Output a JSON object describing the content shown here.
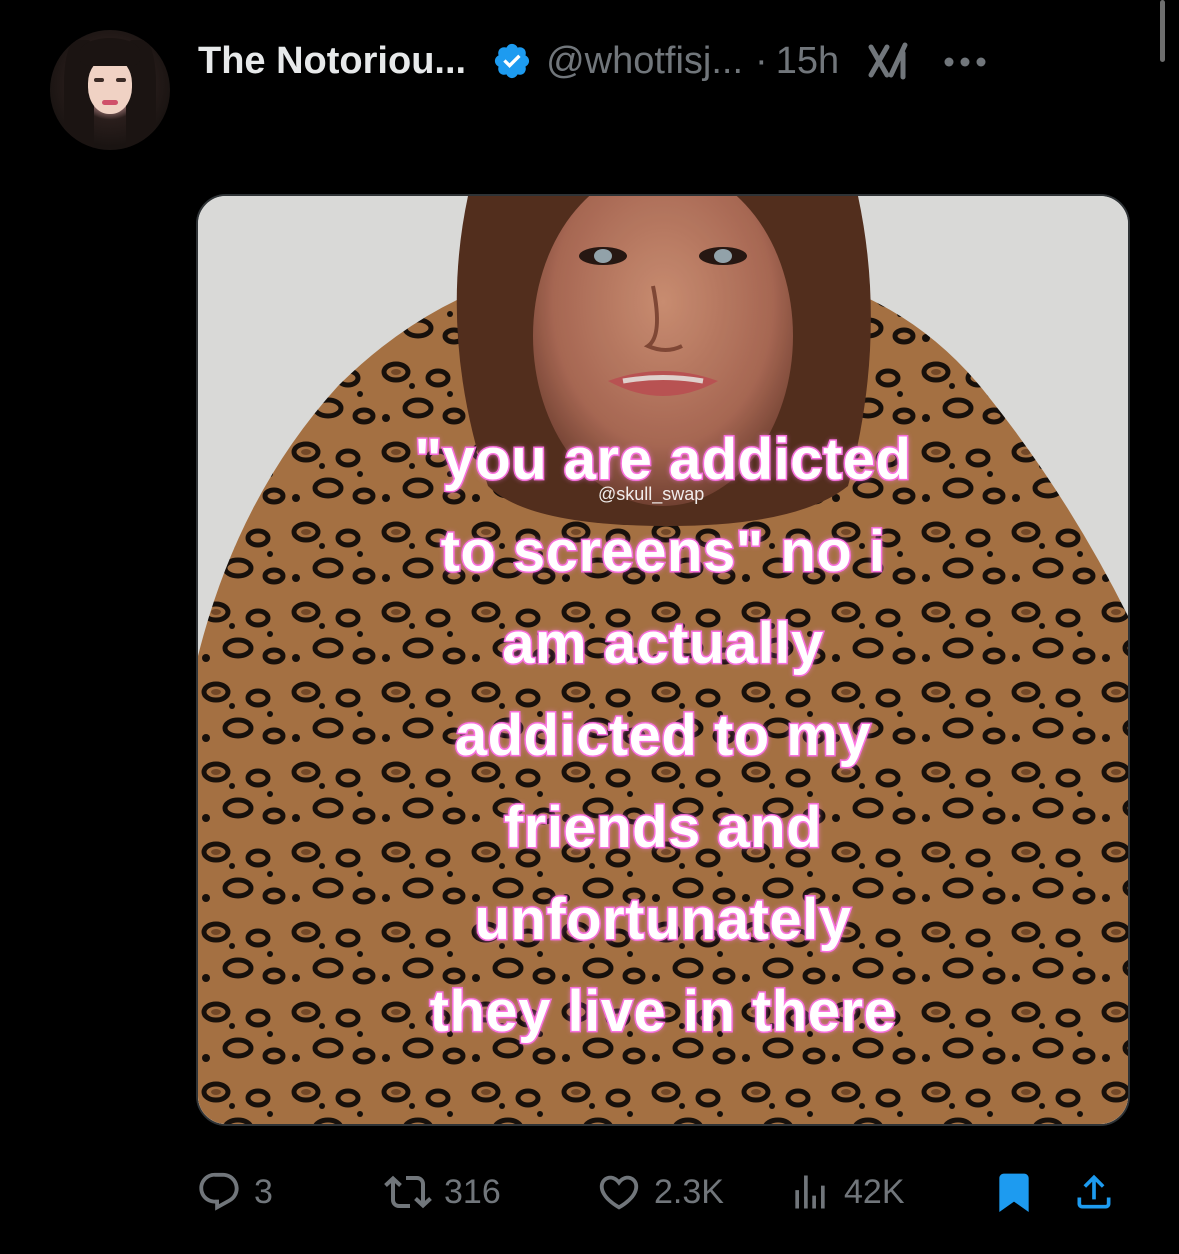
{
  "tweet": {
    "display_name": "The Notoriou...",
    "handle": "@whotfisj...",
    "separator": "·",
    "time": "15h"
  },
  "media": {
    "meme_lines": [
      "\"you are addicted",
      "to screens\" no i",
      "am actually",
      "addicted to my",
      "friends and",
      "unfortunately",
      "they live in there"
    ],
    "watermark": "@skull_swap"
  },
  "actions": {
    "replies": "3",
    "reposts": "316",
    "likes": "2.3K",
    "views": "42K"
  },
  "icons": {
    "verified": "verified-badge-icon",
    "grok": "grok-icon",
    "more": "more-icon",
    "reply": "reply-icon",
    "repost": "repost-icon",
    "like": "heart-icon",
    "views": "views-icon",
    "bookmark": "bookmark-icon",
    "share": "share-icon"
  },
  "colors": {
    "background": "#000000",
    "text": "#e7e9ea",
    "secondary": "#71767b",
    "verified": "#1d9bf0",
    "bookmark_active": "#1d9bf0",
    "meme_outline": "#f06fd8"
  }
}
